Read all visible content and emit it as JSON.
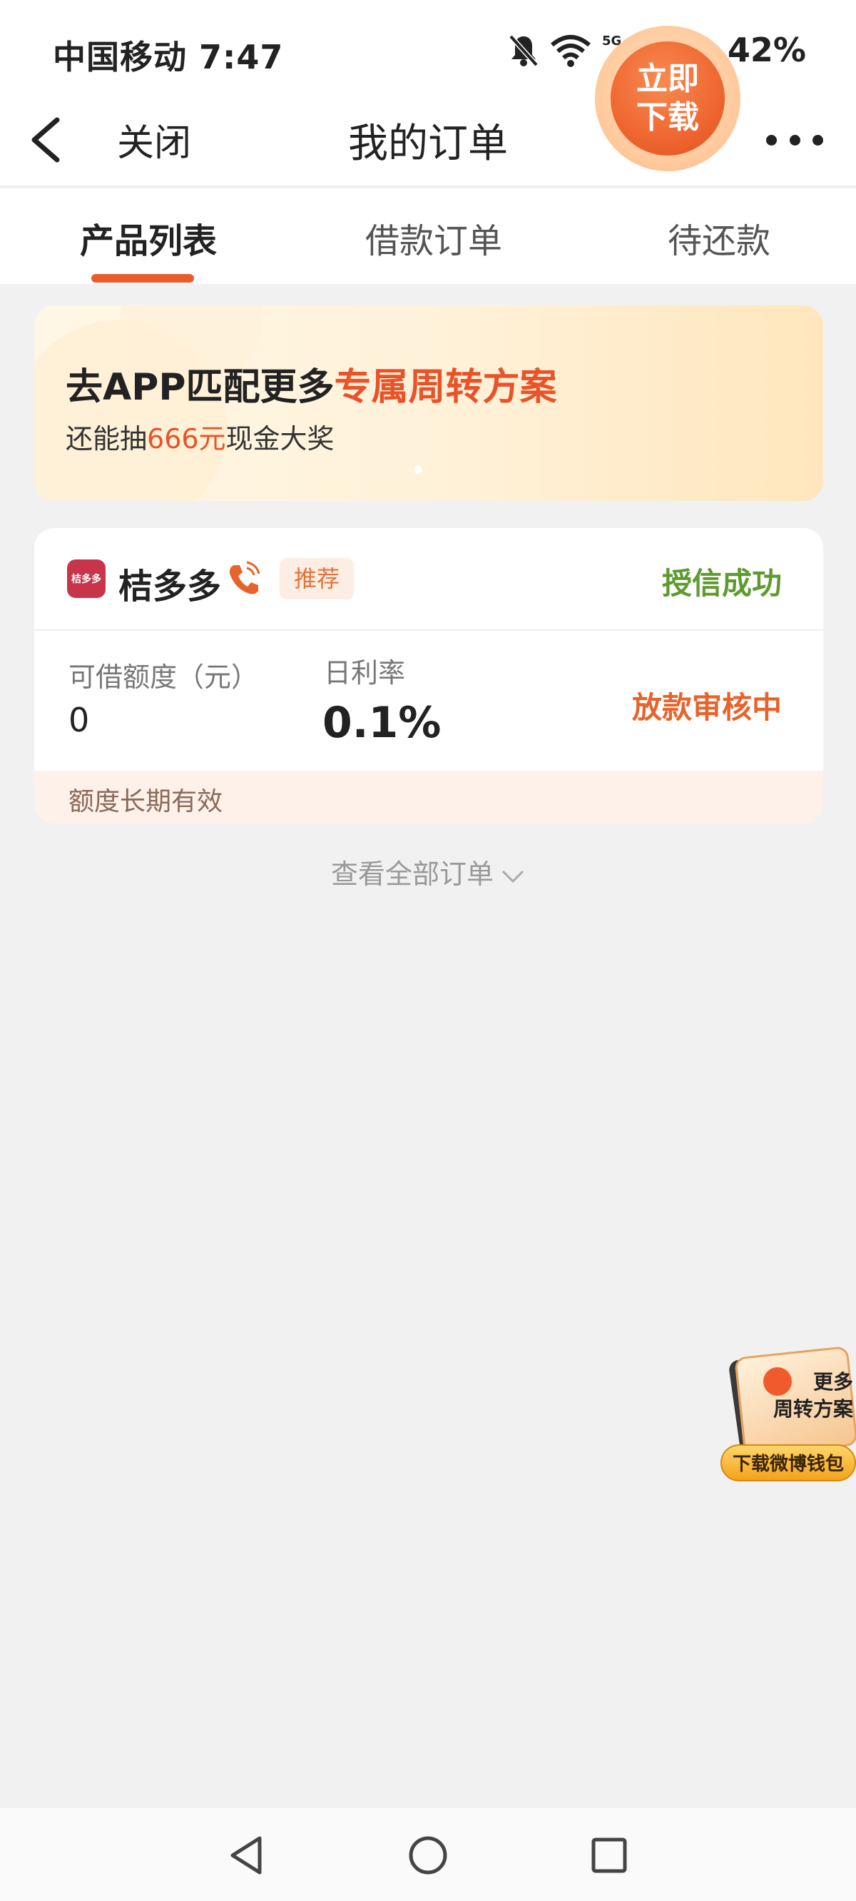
{
  "status_bar": {
    "carrier_time": "中国移动 7:47",
    "battery": "42%"
  },
  "nav": {
    "close_label": "关闭",
    "title": "我的订单"
  },
  "tabs": [
    {
      "label": "产品列表",
      "active": true
    },
    {
      "label": "借款订单",
      "active": false
    },
    {
      "label": "待还款",
      "active": false
    }
  ],
  "banner": {
    "title_prefix": "去APP匹配更多",
    "title_highlight": "专属周转方案",
    "sub_prefix": "还能抽",
    "sub_highlight": "666元",
    "sub_suffix": "现金大奖",
    "button_line1": "立即",
    "button_line2": "下载"
  },
  "order_card": {
    "app_name": "桔多多",
    "app_logo_text": "桔多多",
    "badge": "推荐",
    "credit_status": "授信成功",
    "amount_label": "可借额度（元）",
    "amount_value": "0",
    "rate_label": "日利率",
    "rate_value": "0.1%",
    "loan_status": "放款审核中",
    "footer_note": "额度长期有效"
  },
  "view_all": "查看全部订单",
  "float_promo": {
    "line1": "更多",
    "line2": "周转方案",
    "button": "下载微博钱包"
  },
  "colors": {
    "accent": "#e95d2c",
    "success": "#5f9a30",
    "background": "#f1f1f1"
  }
}
